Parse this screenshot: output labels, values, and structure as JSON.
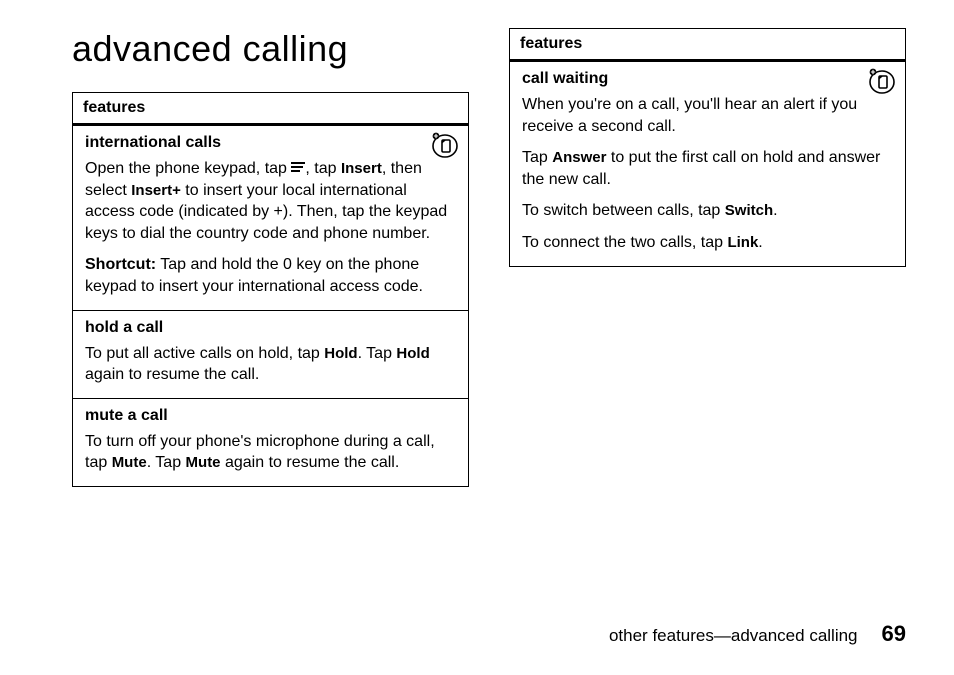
{
  "title": "advanced calling",
  "left": {
    "header": "features",
    "sections": [
      {
        "title": "international calls",
        "icon": true,
        "paragraphs": [
          {
            "html": "Open the phone keypad, tap {MENU}, tap {UI:Insert}, then select {UI:Insert+} to insert your local international access code (indicated by +). Then, tap the keypad keys to dial the country code and phone number."
          },
          {
            "html": "{B:Shortcut:} Tap and hold the 0 key on the phone keypad to insert your international access code."
          }
        ]
      },
      {
        "title": "hold a call",
        "icon": false,
        "paragraphs": [
          {
            "html": "To put all active calls on hold, tap {UI:Hold}. Tap {UI:Hold} again to resume the call."
          }
        ]
      },
      {
        "title": "mute a call",
        "icon": false,
        "paragraphs": [
          {
            "html": "To turn off your phone's microphone during a call, tap {UI:Mute}. Tap {UI:Mute} again to resume the call."
          }
        ]
      }
    ]
  },
  "right": {
    "header": "features",
    "sections": [
      {
        "title": "call waiting",
        "icon": true,
        "paragraphs": [
          {
            "html": "When you're on a call, you'll hear an alert if you receive a second call."
          },
          {
            "html": "Tap {UI:Answer} to put the first call on hold and answer the new call."
          },
          {
            "html": "To switch between calls, tap {UI:Switch}."
          },
          {
            "html": "To connect the two calls, tap {UI:Link}."
          }
        ]
      }
    ]
  },
  "footer": {
    "text": "other features—advanced calling",
    "page": "69"
  }
}
